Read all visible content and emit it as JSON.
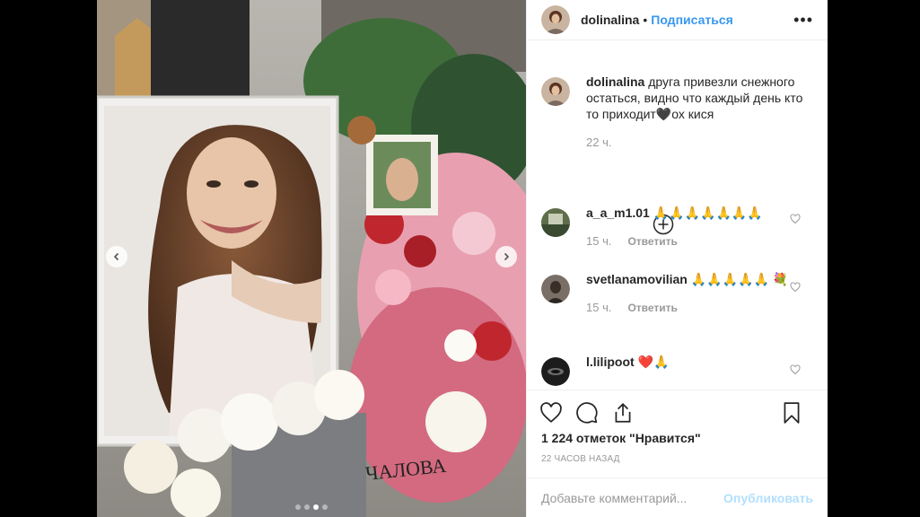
{
  "header": {
    "username": "dolinalina",
    "separator": "•",
    "follow_label": "Подписаться",
    "more_label": "•••"
  },
  "caption": {
    "username": "dolinalina",
    "text": "друга привезли снежного остаться, видно что каждый день кто то приходит🖤ох кися",
    "time": "22 ч."
  },
  "comments": [
    {
      "username": "a_a_m1.01",
      "text": "🙏🙏🙏🙏🙏🙏🙏",
      "time": "15 ч.",
      "reply": "Ответить"
    },
    {
      "username": "svetlanamovilian",
      "text": "🙏🙏🙏🙏🙏 💐",
      "time": "15 ч.",
      "reply": "Ответить"
    },
    {
      "username": "l.lilipoot",
      "text": "❤️🙏"
    }
  ],
  "likes": "1 224 отметок \"Нравится\"",
  "time_ago": "22 часов назад",
  "add_comment": {
    "placeholder": "Добавьте комментарий...",
    "publish_label": "Опубликовать"
  },
  "carousel": {
    "total": 4,
    "active": 2
  },
  "photo": {
    "plaque_text": "ЧАЛОВА"
  },
  "colors": {
    "link": "#3897f0",
    "publish_disabled": "#b2dffc",
    "text": "#262626",
    "meta": "#999999"
  }
}
